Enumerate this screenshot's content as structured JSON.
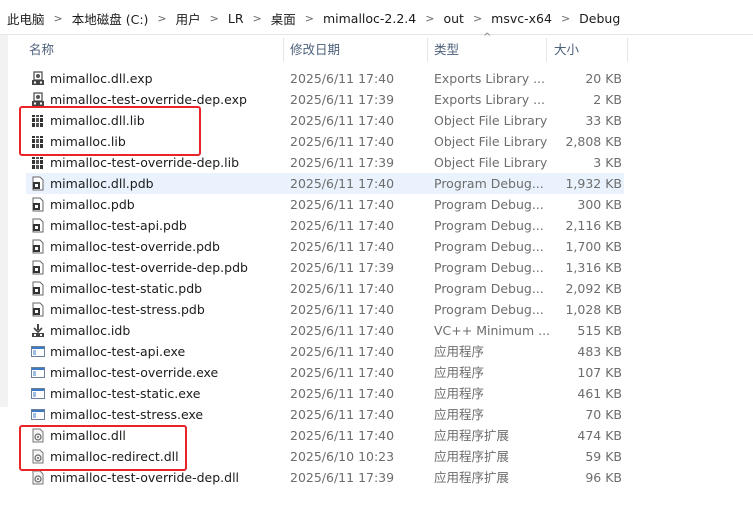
{
  "breadcrumb": [
    "此电脑",
    "本地磁盘 (C:)",
    "用户",
    "LR",
    "桌面",
    "mimalloc-2.2.4",
    "out",
    "msvc-x64",
    "Debug"
  ],
  "columns": {
    "name": "名称",
    "date": "修改日期",
    "type": "类型",
    "size": "大小"
  },
  "sort_indicator": "^",
  "files": [
    {
      "name": "mimalloc.dll.exp",
      "date": "2025/6/11 17:40",
      "type": "Exports Library ...",
      "size": "20 KB",
      "icon": "exports-library-icon"
    },
    {
      "name": "mimalloc-test-override-dep.exp",
      "date": "2025/6/11 17:39",
      "type": "Exports Library ...",
      "size": "2 KB",
      "icon": "exports-library-icon"
    },
    {
      "name": "mimalloc.dll.lib",
      "date": "2025/6/11 17:40",
      "type": "Object File Library",
      "size": "33 KB",
      "icon": "object-library-icon"
    },
    {
      "name": "mimalloc.lib",
      "date": "2025/6/11 17:40",
      "type": "Object File Library",
      "size": "2,808 KB",
      "icon": "object-library-icon"
    },
    {
      "name": "mimalloc-test-override-dep.lib",
      "date": "2025/6/11 17:39",
      "type": "Object File Library",
      "size": "3 KB",
      "icon": "object-library-icon"
    },
    {
      "name": "mimalloc.dll.pdb",
      "date": "2025/6/11 17:40",
      "type": "Program Debug...",
      "size": "1,932 KB",
      "icon": "program-debug-icon"
    },
    {
      "name": "mimalloc.pdb",
      "date": "2025/6/11 17:40",
      "type": "Program Debug...",
      "size": "300 KB",
      "icon": "program-debug-icon"
    },
    {
      "name": "mimalloc-test-api.pdb",
      "date": "2025/6/11 17:40",
      "type": "Program Debug...",
      "size": "2,116 KB",
      "icon": "program-debug-icon"
    },
    {
      "name": "mimalloc-test-override.pdb",
      "date": "2025/6/11 17:40",
      "type": "Program Debug...",
      "size": "1,700 KB",
      "icon": "program-debug-icon"
    },
    {
      "name": "mimalloc-test-override-dep.pdb",
      "date": "2025/6/11 17:39",
      "type": "Program Debug...",
      "size": "1,316 KB",
      "icon": "program-debug-icon"
    },
    {
      "name": "mimalloc-test-static.pdb",
      "date": "2025/6/11 17:40",
      "type": "Program Debug...",
      "size": "2,092 KB",
      "icon": "program-debug-icon"
    },
    {
      "name": "mimalloc-test-stress.pdb",
      "date": "2025/6/11 17:40",
      "type": "Program Debug...",
      "size": "1,028 KB",
      "icon": "program-debug-icon"
    },
    {
      "name": "mimalloc.idb",
      "date": "2025/6/11 17:40",
      "type": "VC++ Minimum ...",
      "size": "515 KB",
      "icon": "vc-minimum-icon"
    },
    {
      "name": "mimalloc-test-api.exe",
      "date": "2025/6/11 17:40",
      "type": "应用程序",
      "size": "483 KB",
      "icon": "application-icon"
    },
    {
      "name": "mimalloc-test-override.exe",
      "date": "2025/6/11 17:40",
      "type": "应用程序",
      "size": "107 KB",
      "icon": "application-icon"
    },
    {
      "name": "mimalloc-test-static.exe",
      "date": "2025/6/11 17:40",
      "type": "应用程序",
      "size": "461 KB",
      "icon": "application-icon"
    },
    {
      "name": "mimalloc-test-stress.exe",
      "date": "2025/6/11 17:40",
      "type": "应用程序",
      "size": "70 KB",
      "icon": "application-icon"
    },
    {
      "name": "mimalloc.dll",
      "date": "2025/6/11 17:40",
      "type": "应用程序扩展",
      "size": "474 KB",
      "icon": "dll-icon"
    },
    {
      "name": "mimalloc-redirect.dll",
      "date": "2025/6/10 10:23",
      "type": "应用程序扩展",
      "size": "59 KB",
      "icon": "dll-icon"
    },
    {
      "name": "mimalloc-test-override-dep.dll",
      "date": "2025/6/11 17:39",
      "type": "应用程序扩展",
      "size": "96 KB",
      "icon": "dll-icon"
    }
  ],
  "selected_file": "mimalloc.dll.pdb",
  "highlight_color": "#e8232a",
  "selection_color": "#eaf3fd"
}
